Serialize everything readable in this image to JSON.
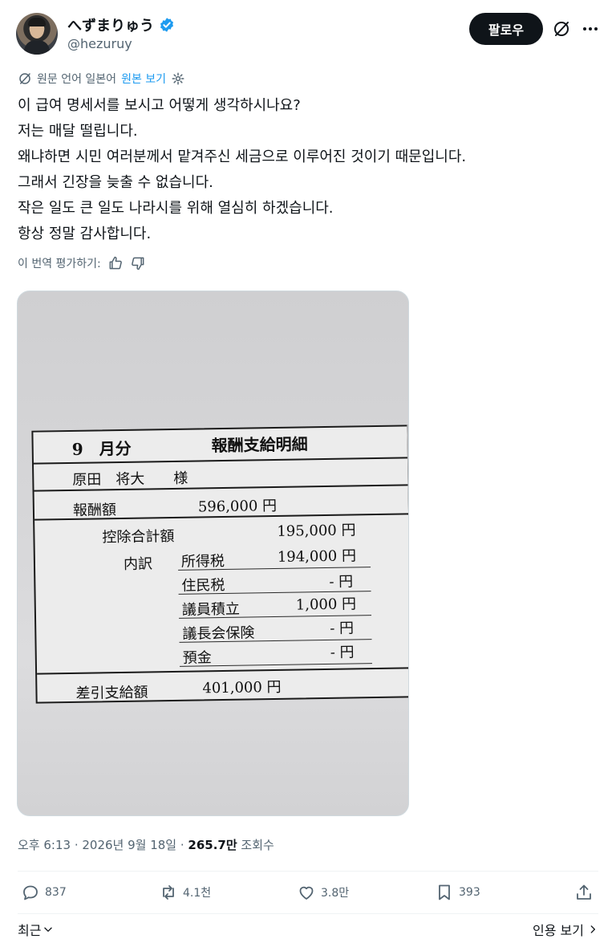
{
  "author": {
    "display_name": "へずまりゅう",
    "handle": "@hezuruy",
    "verified": true
  },
  "header": {
    "follow_label": "팔로우"
  },
  "translation": {
    "source_language": "원문 언어 일본어",
    "show_original": "원본 보기"
  },
  "tweet": {
    "lines": [
      "이 급여 명세서를 보시고 어떻게 생각하시나요?",
      "저는 매달 떨립니다.",
      "왜냐하면 시민 여러분께서 맡겨주신 세금으로 이루어진 것이기 때문입니다.",
      "그래서 긴장을 늦출 수 없습니다.",
      "작은 일도 큰 일도 나라시를 위해 열심히 하겠습니다.",
      "항상 정말 감사합니다."
    ]
  },
  "rate_translation": "이 번역 평가하기:",
  "photo": {
    "month": "9　月分",
    "title": "報酬支給明細",
    "name": "原田　将大　　様",
    "salary_label": "報酬額",
    "salary_value": "596,000 円",
    "deduction_total_label": "控除合計額",
    "deduction_total_value": "195,000 円",
    "breakdown_label": "内訳",
    "items": [
      {
        "label": "所得税",
        "value": "194,000 円"
      },
      {
        "label": "住民税",
        "value": "- 円"
      },
      {
        "label": "議員積立",
        "value": "1,000 円"
      },
      {
        "label": "議長会保険",
        "value": "- 円"
      },
      {
        "label": "預金",
        "value": "- 円"
      }
    ],
    "net_label": "差引支給額",
    "net_value": "401,000 円"
  },
  "meta": {
    "time": "오후 6:13 · 2026년 9월 18일 · ",
    "views": "265.7만",
    "views_label": " 조회수"
  },
  "actions": {
    "replies": "837",
    "reposts": "4.1천",
    "likes": "3.8만",
    "bookmarks": "393"
  },
  "bottom": {
    "sort_label": "최근",
    "quotes_label": "인용 보기"
  },
  "colors": {
    "accent": "#1d9bf0",
    "text": "#0f1419",
    "muted": "#536471"
  }
}
